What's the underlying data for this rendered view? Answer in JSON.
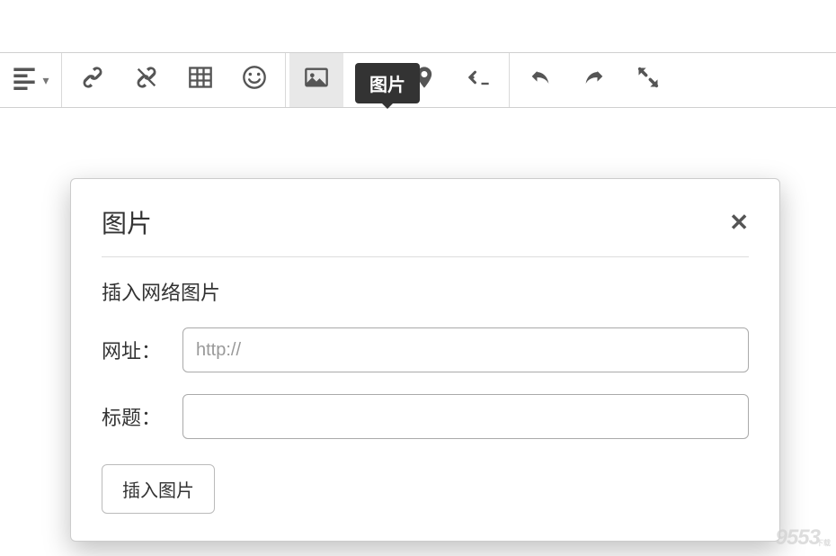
{
  "tooltip": {
    "image": "图片"
  },
  "toolbar": {
    "align_icon": "align-left-icon",
    "link_icon": "link-icon",
    "unlink_icon": "unlink-icon",
    "table_icon": "table-icon",
    "emoji_icon": "smile-icon",
    "image_icon": "image-icon",
    "video_icon": "video-icon",
    "location_icon": "location-icon",
    "code_icon": "code-icon",
    "undo_icon": "undo-icon",
    "redo_icon": "redo-icon",
    "fullscreen_icon": "fullscreen-icon"
  },
  "dialog": {
    "title": "图片",
    "section_label": "插入网络图片",
    "url_label": "网址：",
    "url_placeholder": "http://",
    "url_value": "",
    "title_label": "标题：",
    "title_value": "",
    "submit_label": "插入图片"
  },
  "watermark": {
    "main": "9553",
    "sub": "下载"
  }
}
